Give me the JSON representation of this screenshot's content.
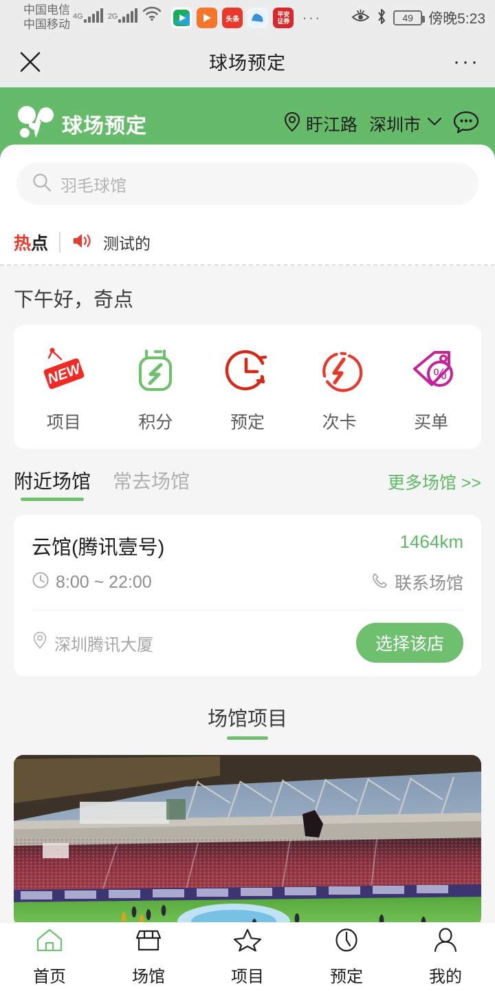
{
  "statusbar": {
    "carrier_primary": "中国电信",
    "carrier_secondary": "中国移动",
    "network_primary": "4G",
    "network_secondary": "2G",
    "app_icons": [
      "tencent-video-icon",
      "orange-play-icon",
      "toutiao-icon",
      "cloud-icon",
      "pingan-securities-icon"
    ],
    "overflow": "···",
    "battery_level": "49",
    "time": "傍晚5:23",
    "icons": [
      "eye-care-icon",
      "bluetooth-icon",
      "battery-icon"
    ]
  },
  "navbar": {
    "title": "球场预定",
    "close_label": "×",
    "more_label": "···"
  },
  "header": {
    "brand_name": "球场预定",
    "location": "盱江路",
    "city": "深圳市",
    "chevron": "⌄"
  },
  "search": {
    "placeholder": "羽毛球馆",
    "value": ""
  },
  "hotspot": {
    "label_red": "热",
    "label_dark": "点",
    "message": "测试的"
  },
  "greeting": "下午好，奇点",
  "quick_actions": [
    {
      "label": "项目",
      "icon": "new-tag-icon",
      "color": "#ef2b23"
    },
    {
      "label": "积分",
      "icon": "points-icon",
      "color": "#6ec06f"
    },
    {
      "label": "预定",
      "icon": "clock-refresh-icon",
      "color": "#d22a16"
    },
    {
      "label": "次卡",
      "icon": "lightning-card-icon",
      "color": "#e8372b"
    },
    {
      "label": "买单",
      "icon": "discount-tag-icon",
      "color": "#c2239a"
    }
  ],
  "venue_section": {
    "tabs": [
      {
        "label": "附近场馆",
        "active": true
      },
      {
        "label": "常去场馆",
        "active": false
      }
    ],
    "more_link": "更多场馆 >>",
    "card": {
      "name": "云馆(腾讯壹号)",
      "distance": "1464km",
      "hours": "8:00 ~ 22:00",
      "contact": "联系场馆",
      "address": "深圳腾讯大厦",
      "select_button": "选择该店"
    }
  },
  "projects_section": {
    "title": "场馆项目",
    "photo_alt": "stadium-photo"
  },
  "tabbar": [
    {
      "label": "首页",
      "icon": "home-icon",
      "active": true
    },
    {
      "label": "场馆",
      "icon": "shop-icon",
      "active": false
    },
    {
      "label": "项目",
      "icon": "star-icon",
      "active": false
    },
    {
      "label": "预定",
      "icon": "clock-icon",
      "active": false
    },
    {
      "label": "我的",
      "icon": "person-icon",
      "active": false
    }
  ],
  "colors": {
    "brand_green": "#66bb6a",
    "accent_green": "#6ec06f",
    "page_bg": "#f5f5f5",
    "status_bg": "#ececec"
  }
}
